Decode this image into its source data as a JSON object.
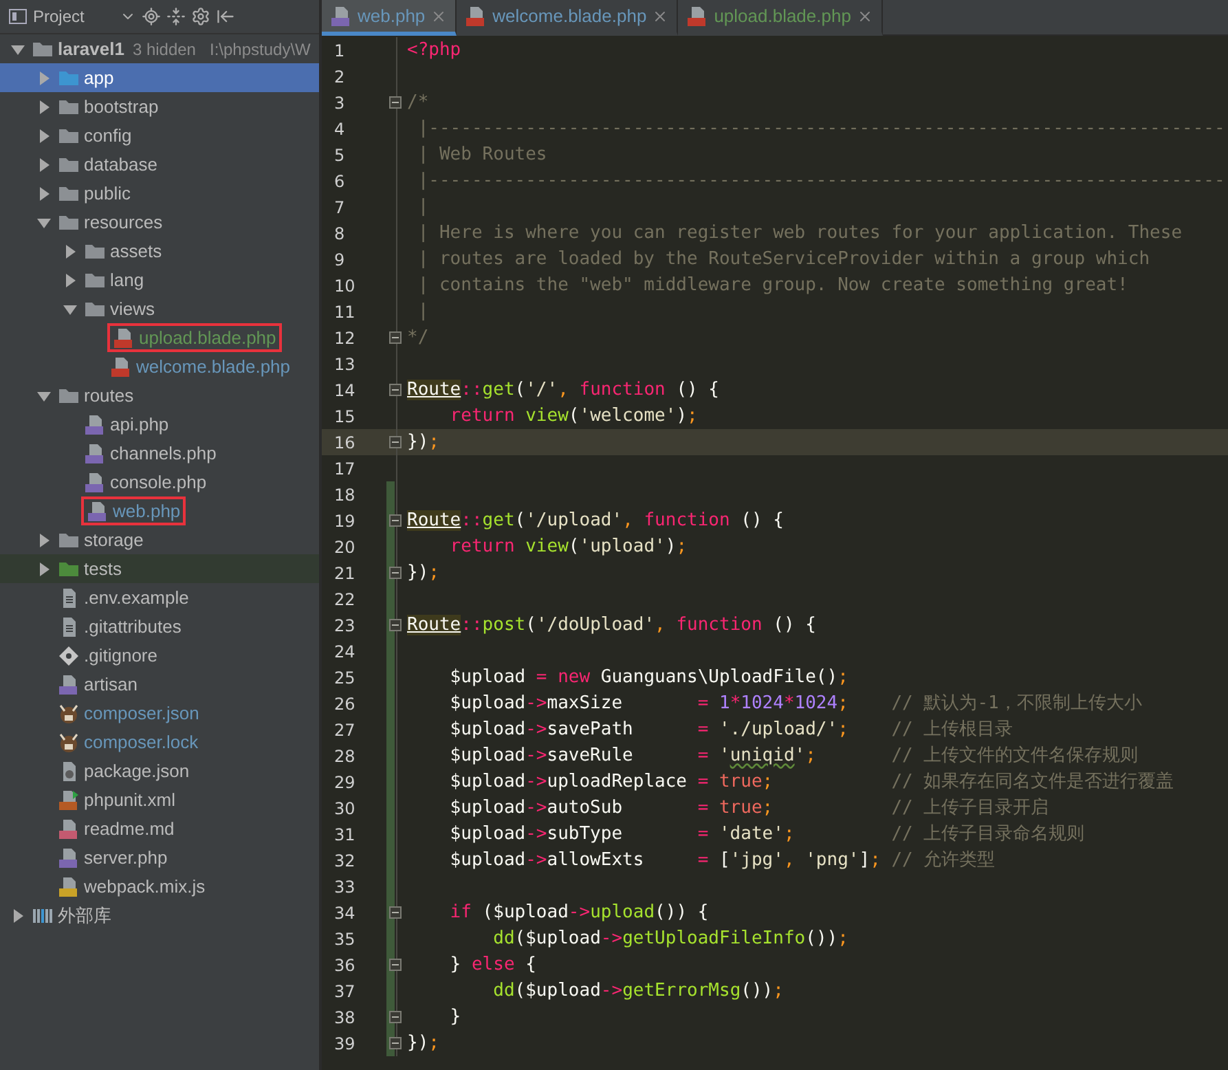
{
  "project_panel": {
    "title": "Project",
    "tree": [
      {
        "label": "laravel1",
        "note": "3 hidden",
        "path": "I:\\phpstudy\\W",
        "kind": "folder",
        "expanded": true,
        "selected": false,
        "boxed": false,
        "children": [
          {
            "label": "app",
            "kind": "folder-src",
            "expanded": false,
            "selected": true,
            "boxed": false
          },
          {
            "label": "bootstrap",
            "kind": "folder",
            "expanded": false,
            "selected": false,
            "boxed": false
          },
          {
            "label": "config",
            "kind": "folder",
            "expanded": false,
            "selected": false,
            "boxed": false
          },
          {
            "label": "database",
            "kind": "folder",
            "expanded": false,
            "selected": false,
            "boxed": false
          },
          {
            "label": "public",
            "kind": "folder",
            "expanded": false,
            "selected": false,
            "boxed": false
          },
          {
            "label": "resources",
            "kind": "folder",
            "expanded": true,
            "selected": false,
            "boxed": false,
            "children": [
              {
                "label": "assets",
                "kind": "folder",
                "expanded": false,
                "selected": false,
                "boxed": false
              },
              {
                "label": "lang",
                "kind": "folder",
                "expanded": false,
                "selected": false,
                "boxed": false
              },
              {
                "label": "views",
                "kind": "folder",
                "expanded": true,
                "selected": false,
                "boxed": false,
                "children": [
                  {
                    "label": "upload.blade.php",
                    "kind": "blade",
                    "selected": false,
                    "boxed": true,
                    "color": "#629755"
                  },
                  {
                    "label": "welcome.blade.php",
                    "kind": "blade",
                    "selected": false,
                    "boxed": false,
                    "color": "#6897bb"
                  }
                ]
              }
            ]
          },
          {
            "label": "routes",
            "kind": "folder",
            "expanded": true,
            "selected": false,
            "boxed": false,
            "children": [
              {
                "label": "api.php",
                "kind": "php",
                "selected": false,
                "boxed": false
              },
              {
                "label": "channels.php",
                "kind": "php",
                "selected": false,
                "boxed": false
              },
              {
                "label": "console.php",
                "kind": "php",
                "selected": false,
                "boxed": false
              },
              {
                "label": "web.php",
                "kind": "php",
                "selected": false,
                "boxed": true,
                "color": "#6897bb"
              }
            ]
          },
          {
            "label": "storage",
            "kind": "folder",
            "expanded": false,
            "selected": false,
            "boxed": false
          },
          {
            "label": "tests",
            "kind": "folder-test",
            "expanded": false,
            "selected": false,
            "boxed": false
          },
          {
            "label": ".env.example",
            "kind": "text",
            "selected": false,
            "boxed": false
          },
          {
            "label": ".gitattributes",
            "kind": "text",
            "selected": false,
            "boxed": false
          },
          {
            "label": ".gitignore",
            "kind": "git",
            "selected": false,
            "boxed": false
          },
          {
            "label": "artisan",
            "kind": "php",
            "selected": false,
            "boxed": false
          },
          {
            "label": "composer.json",
            "kind": "composer",
            "selected": false,
            "boxed": false,
            "color": "#6897bb"
          },
          {
            "label": "composer.lock",
            "kind": "composer",
            "selected": false,
            "boxed": false,
            "color": "#6897bb"
          },
          {
            "label": "package.json",
            "kind": "json",
            "selected": false,
            "boxed": false
          },
          {
            "label": "phpunit.xml",
            "kind": "xml",
            "selected": false,
            "boxed": false
          },
          {
            "label": "readme.md",
            "kind": "md",
            "selected": false,
            "boxed": false
          },
          {
            "label": "server.php",
            "kind": "php",
            "selected": false,
            "boxed": false
          },
          {
            "label": "webpack.mix.js",
            "kind": "js",
            "selected": false,
            "boxed": false
          }
        ]
      },
      {
        "label": "外部库",
        "kind": "library",
        "expanded": false,
        "selected": false,
        "boxed": false
      }
    ]
  },
  "editor": {
    "tabs": [
      {
        "label": "web.php",
        "kind": "php",
        "selected": true,
        "color": "#6897bb"
      },
      {
        "label": "welcome.blade.php",
        "kind": "blade",
        "selected": false,
        "color": "#6897bb"
      },
      {
        "label": "upload.blade.php",
        "kind": "blade",
        "selected": false,
        "color": "#629755"
      }
    ],
    "lines": [
      {
        "number": "1",
        "current": false,
        "changed": false,
        "fold": false,
        "tokens": [
          {
            "text": "<?php",
            "kind": "tag"
          }
        ]
      },
      {
        "number": "2",
        "current": false,
        "changed": false,
        "fold": false
      },
      {
        "number": "3",
        "current": false,
        "changed": false,
        "fold": true,
        "tokens": [
          {
            "text": "/*",
            "kind": "comment"
          }
        ]
      },
      {
        "number": "4",
        "current": false,
        "changed": false,
        "fold": false,
        "tokens": [
          {
            "text": " |--------------------------------------------------------------------------",
            "kind": "comment"
          }
        ]
      },
      {
        "number": "5",
        "current": false,
        "changed": false,
        "fold": false,
        "tokens": [
          {
            "text": " | Web Routes",
            "kind": "comment"
          }
        ]
      },
      {
        "number": "6",
        "current": false,
        "changed": false,
        "fold": false,
        "tokens": [
          {
            "text": " |--------------------------------------------------------------------------",
            "kind": "comment"
          }
        ]
      },
      {
        "number": "7",
        "current": false,
        "changed": false,
        "fold": false,
        "tokens": [
          {
            "text": " |",
            "kind": "comment"
          }
        ]
      },
      {
        "number": "8",
        "current": false,
        "changed": false,
        "fold": false,
        "tokens": [
          {
            "text": " | Here is where you can register web routes for your application. These",
            "kind": "comment"
          }
        ]
      },
      {
        "number": "9",
        "current": false,
        "changed": false,
        "fold": false,
        "tokens": [
          {
            "text": " | routes are loaded by the RouteServiceProvider within a group which",
            "kind": "comment"
          }
        ]
      },
      {
        "number": "10",
        "current": false,
        "changed": false,
        "fold": false,
        "tokens": [
          {
            "text": " | contains the \"web\" middleware group. Now create something great!",
            "kind": "comment"
          }
        ]
      },
      {
        "number": "11",
        "current": false,
        "changed": false,
        "fold": false,
        "tokens": [
          {
            "text": " |",
            "kind": "comment"
          }
        ]
      },
      {
        "number": "12",
        "current": false,
        "changed": false,
        "fold": true,
        "tokens": [
          {
            "text": "*/",
            "kind": "comment"
          }
        ]
      },
      {
        "number": "13",
        "current": false,
        "changed": false,
        "fold": false
      },
      {
        "number": "14",
        "current": false,
        "changed": false,
        "fold": true,
        "tokens": [
          {
            "text": "Route",
            "kind": "cls"
          },
          {
            "text": "::",
            "kind": "op"
          },
          {
            "text": "get",
            "kind": "fn"
          },
          {
            "text": "(",
            "kind": "plain"
          },
          {
            "text": "'/'",
            "kind": "str"
          },
          {
            "text": ", ",
            "kind": "punc"
          },
          {
            "text": "function",
            "kind": "kw"
          },
          {
            "text": " () {",
            "kind": "plain"
          }
        ]
      },
      {
        "number": "15",
        "current": false,
        "changed": false,
        "fold": false,
        "tokens": [
          {
            "text": "    return",
            "kind": "kw"
          },
          {
            "text": " view",
            "kind": "fn"
          },
          {
            "text": "(",
            "kind": "plain"
          },
          {
            "text": "'welcome'",
            "kind": "str"
          },
          {
            "text": ")",
            "kind": "plain"
          },
          {
            "text": ";",
            "kind": "punc"
          }
        ]
      },
      {
        "number": "16",
        "current": true,
        "changed": false,
        "fold": true,
        "tokens": [
          {
            "text": "})",
            "kind": "plain"
          },
          {
            "text": ";",
            "kind": "punc"
          }
        ]
      },
      {
        "number": "17",
        "current": false,
        "changed": false,
        "fold": false
      },
      {
        "number": "18",
        "current": false,
        "changed": true,
        "fold": false
      },
      {
        "number": "19",
        "current": false,
        "changed": true,
        "fold": true,
        "tokens": [
          {
            "text": "Route",
            "kind": "cls"
          },
          {
            "text": "::",
            "kind": "op"
          },
          {
            "text": "get",
            "kind": "fn"
          },
          {
            "text": "(",
            "kind": "plain"
          },
          {
            "text": "'/upload'",
            "kind": "str"
          },
          {
            "text": ", ",
            "kind": "punc"
          },
          {
            "text": "function",
            "kind": "kw"
          },
          {
            "text": " () {",
            "kind": "plain"
          }
        ]
      },
      {
        "number": "20",
        "current": false,
        "changed": true,
        "fold": false,
        "tokens": [
          {
            "text": "    return",
            "kind": "kw"
          },
          {
            "text": " view",
            "kind": "fn"
          },
          {
            "text": "(",
            "kind": "plain"
          },
          {
            "text": "'upload'",
            "kind": "str"
          },
          {
            "text": ")",
            "kind": "plain"
          },
          {
            "text": ";",
            "kind": "punc"
          }
        ]
      },
      {
        "number": "21",
        "current": false,
        "changed": true,
        "fold": true,
        "tokens": [
          {
            "text": "})",
            "kind": "plain"
          },
          {
            "text": ";",
            "kind": "punc"
          }
        ]
      },
      {
        "number": "22",
        "current": false,
        "changed": true,
        "fold": false
      },
      {
        "number": "23",
        "current": false,
        "changed": true,
        "fold": true,
        "tokens": [
          {
            "text": "Route",
            "kind": "cls"
          },
          {
            "text": "::",
            "kind": "op"
          },
          {
            "text": "post",
            "kind": "fn"
          },
          {
            "text": "(",
            "kind": "plain"
          },
          {
            "text": "'/doUpload'",
            "kind": "str"
          },
          {
            "text": ", ",
            "kind": "punc"
          },
          {
            "text": "function",
            "kind": "kw"
          },
          {
            "text": " () {",
            "kind": "plain"
          }
        ]
      },
      {
        "number": "24",
        "current": false,
        "changed": true,
        "fold": false
      },
      {
        "number": "25",
        "current": false,
        "changed": true,
        "fold": false,
        "tokens": [
          {
            "text": "    $upload ",
            "kind": "plain"
          },
          {
            "text": "= ",
            "kind": "op"
          },
          {
            "text": "new",
            "kind": "kw"
          },
          {
            "text": " Guanguans\\UploadFile()",
            "kind": "plain"
          },
          {
            "text": ";",
            "kind": "punc"
          }
        ]
      },
      {
        "number": "26",
        "current": false,
        "changed": true,
        "fold": false,
        "tokens": [
          {
            "text": "    $upload",
            "kind": "plain"
          },
          {
            "text": "->",
            "kind": "op"
          },
          {
            "text": "maxSize       ",
            "kind": "plain"
          },
          {
            "text": "= ",
            "kind": "op"
          },
          {
            "text": "1",
            "kind": "num"
          },
          {
            "text": "*",
            "kind": "op"
          },
          {
            "text": "1024",
            "kind": "num"
          },
          {
            "text": "*",
            "kind": "op"
          },
          {
            "text": "1024",
            "kind": "num"
          },
          {
            "text": ";",
            "kind": "punc"
          },
          {
            "text": "    // 默认为-1，不限制上传大小",
            "kind": "comment"
          }
        ]
      },
      {
        "number": "27",
        "current": false,
        "changed": true,
        "fold": false,
        "tokens": [
          {
            "text": "    $upload",
            "kind": "plain"
          },
          {
            "text": "->",
            "kind": "op"
          },
          {
            "text": "savePath      ",
            "kind": "plain"
          },
          {
            "text": "= ",
            "kind": "op"
          },
          {
            "text": "'./upload/'",
            "kind": "str"
          },
          {
            "text": ";",
            "kind": "punc"
          },
          {
            "text": "    // 上传根目录",
            "kind": "comment"
          }
        ]
      },
      {
        "number": "28",
        "current": false,
        "changed": true,
        "fold": false,
        "tokens": [
          {
            "text": "    $upload",
            "kind": "plain"
          },
          {
            "text": "->",
            "kind": "op"
          },
          {
            "text": "saveRule      ",
            "kind": "plain"
          },
          {
            "text": "= ",
            "kind": "op"
          },
          {
            "text": "'",
            "kind": "str"
          },
          {
            "text": "uniqid",
            "kind": "typo"
          },
          {
            "text": "'",
            "kind": "str"
          },
          {
            "text": ";",
            "kind": "punc"
          },
          {
            "text": "       // 上传文件的文件名保存规则",
            "kind": "comment"
          }
        ]
      },
      {
        "number": "29",
        "current": false,
        "changed": true,
        "fold": false,
        "tokens": [
          {
            "text": "    $upload",
            "kind": "plain"
          },
          {
            "text": "->",
            "kind": "op"
          },
          {
            "text": "uploadReplace ",
            "kind": "plain"
          },
          {
            "text": "= ",
            "kind": "op"
          },
          {
            "text": "true",
            "kind": "const"
          },
          {
            "text": ";",
            "kind": "punc"
          },
          {
            "text": "           // 如果存在同名文件是否进行覆盖",
            "kind": "comment"
          }
        ]
      },
      {
        "number": "30",
        "current": false,
        "changed": true,
        "fold": false,
        "tokens": [
          {
            "text": "    $upload",
            "kind": "plain"
          },
          {
            "text": "->",
            "kind": "op"
          },
          {
            "text": "autoSub       ",
            "kind": "plain"
          },
          {
            "text": "= ",
            "kind": "op"
          },
          {
            "text": "true",
            "kind": "const"
          },
          {
            "text": ";",
            "kind": "punc"
          },
          {
            "text": "           // 上传子目录开启",
            "kind": "comment"
          }
        ]
      },
      {
        "number": "31",
        "current": false,
        "changed": true,
        "fold": false,
        "tokens": [
          {
            "text": "    $upload",
            "kind": "plain"
          },
          {
            "text": "->",
            "kind": "op"
          },
          {
            "text": "subType       ",
            "kind": "plain"
          },
          {
            "text": "= ",
            "kind": "op"
          },
          {
            "text": "'date'",
            "kind": "str"
          },
          {
            "text": ";",
            "kind": "punc"
          },
          {
            "text": "         // 上传子目录命名规则",
            "kind": "comment"
          }
        ]
      },
      {
        "number": "32",
        "current": false,
        "changed": true,
        "fold": false,
        "tokens": [
          {
            "text": "    $upload",
            "kind": "plain"
          },
          {
            "text": "->",
            "kind": "op"
          },
          {
            "text": "allowExts     ",
            "kind": "plain"
          },
          {
            "text": "=",
            "kind": "op"
          },
          {
            "text": " [",
            "kind": "plain"
          },
          {
            "text": "'jpg'",
            "kind": "str"
          },
          {
            "text": ", ",
            "kind": "punc"
          },
          {
            "text": "'png'",
            "kind": "str"
          },
          {
            "text": "]",
            "kind": "plain"
          },
          {
            "text": ";",
            "kind": "punc"
          },
          {
            "text": " // 允许类型",
            "kind": "comment"
          }
        ]
      },
      {
        "number": "33",
        "current": false,
        "changed": true,
        "fold": false
      },
      {
        "number": "34",
        "current": false,
        "changed": true,
        "fold": true,
        "tokens": [
          {
            "text": "    if",
            "kind": "kw"
          },
          {
            "text": " ($upload",
            "kind": "plain"
          },
          {
            "text": "->",
            "kind": "op"
          },
          {
            "text": "upload",
            "kind": "fn"
          },
          {
            "text": "()) {",
            "kind": "plain"
          }
        ]
      },
      {
        "number": "35",
        "current": false,
        "changed": true,
        "fold": false,
        "tokens": [
          {
            "text": "        dd",
            "kind": "fn"
          },
          {
            "text": "($upload",
            "kind": "plain"
          },
          {
            "text": "->",
            "kind": "op"
          },
          {
            "text": "getUploadFileInfo",
            "kind": "fn"
          },
          {
            "text": "())",
            "kind": "plain"
          },
          {
            "text": ";",
            "kind": "punc"
          }
        ]
      },
      {
        "number": "36",
        "current": false,
        "changed": true,
        "fold": true,
        "tokens": [
          {
            "text": "    } ",
            "kind": "plain"
          },
          {
            "text": "else",
            "kind": "kw"
          },
          {
            "text": " {",
            "kind": "plain"
          }
        ]
      },
      {
        "number": "37",
        "current": false,
        "changed": true,
        "fold": false,
        "tokens": [
          {
            "text": "        dd",
            "kind": "fn"
          },
          {
            "text": "($upload",
            "kind": "plain"
          },
          {
            "text": "->",
            "kind": "op"
          },
          {
            "text": "getErrorMsg",
            "kind": "fn"
          },
          {
            "text": "())",
            "kind": "plain"
          },
          {
            "text": ";",
            "kind": "punc"
          }
        ]
      },
      {
        "number": "38",
        "current": false,
        "changed": true,
        "fold": true,
        "tokens": [
          {
            "text": "    }",
            "kind": "plain"
          }
        ]
      },
      {
        "number": "39",
        "current": false,
        "changed": true,
        "fold": true,
        "tokens": [
          {
            "text": "})",
            "kind": "plain"
          },
          {
            "text": ";",
            "kind": "punc"
          }
        ]
      }
    ]
  }
}
